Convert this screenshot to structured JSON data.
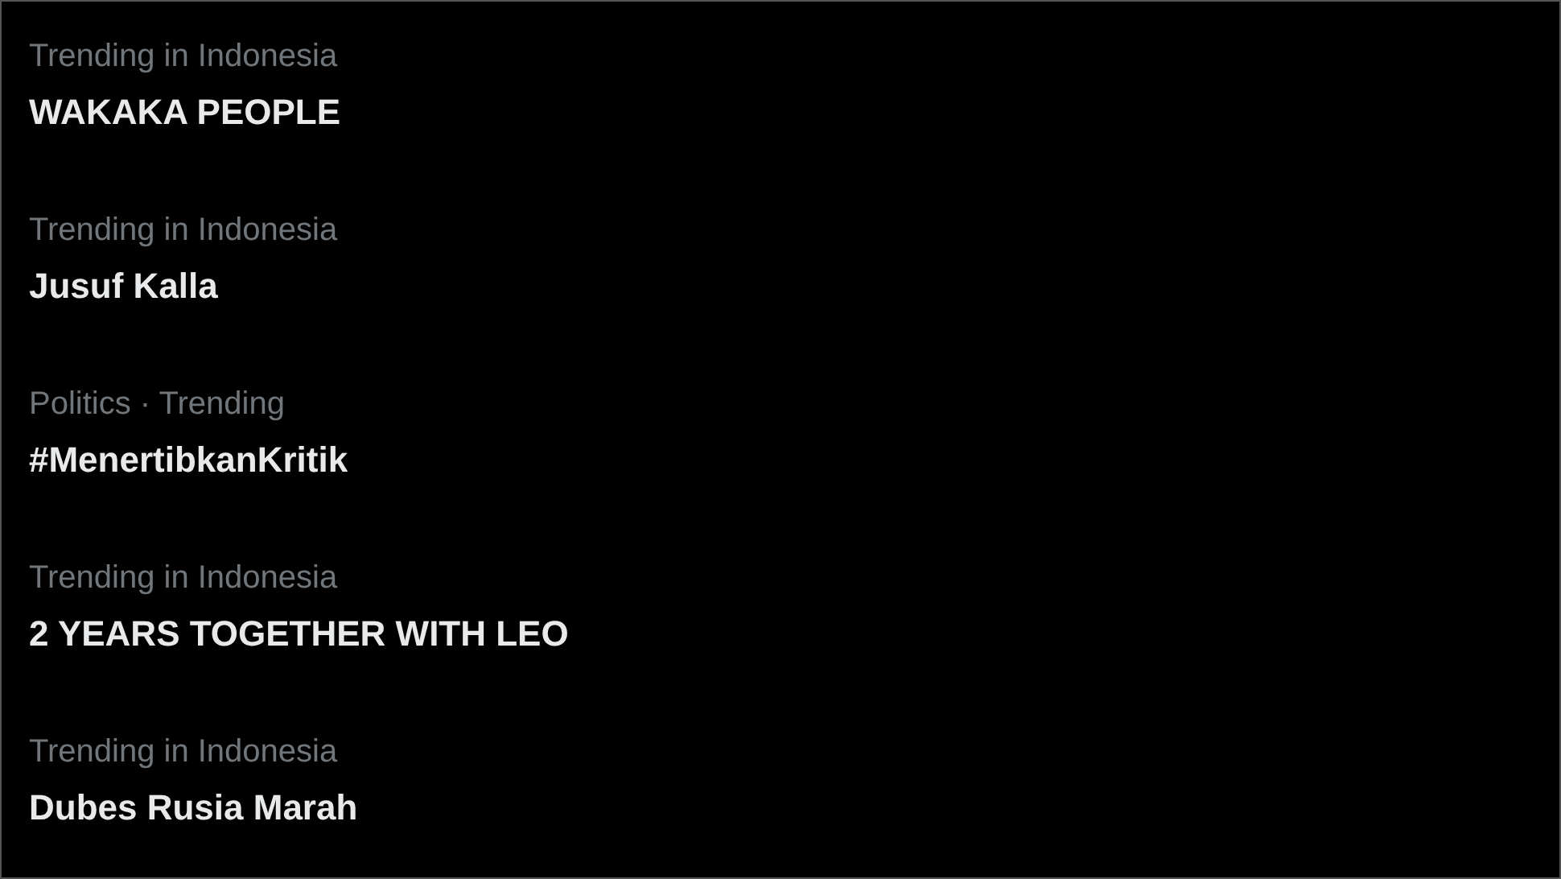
{
  "trends": [
    {
      "context": "Trending in Indonesia",
      "title": "WAKAKA PEOPLE"
    },
    {
      "context": "Trending in Indonesia",
      "title": "Jusuf Kalla"
    },
    {
      "context": "Politics · Trending",
      "title": "#MenertibkanKritik"
    },
    {
      "context": "Trending in Indonesia",
      "title": "2 YEARS TOGETHER WITH LEO"
    },
    {
      "context": "Trending in Indonesia",
      "title": "Dubes Rusia Marah"
    }
  ]
}
